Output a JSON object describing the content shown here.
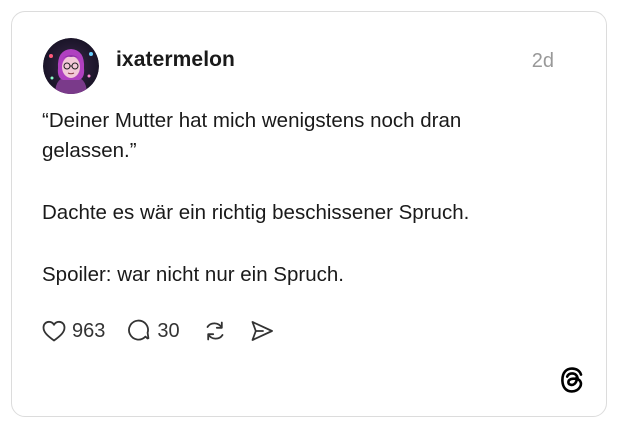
{
  "post": {
    "username": "ixatermelon",
    "timestamp": "2d",
    "lines": [
      "“Deiner Mutter hat mich wenigstens noch dran",
      "gelassen.”",
      "Dachte es wär ein richtig beschissener Spruch.",
      "Spoiler: war nicht nur ein Spruch."
    ]
  },
  "actions": {
    "likes": "963",
    "replies": "30"
  },
  "icons": {
    "like": "heart-icon",
    "reply": "speech-bubble-icon",
    "repost": "repost-icon",
    "share": "send-icon",
    "brand": "threads-logo-icon"
  }
}
